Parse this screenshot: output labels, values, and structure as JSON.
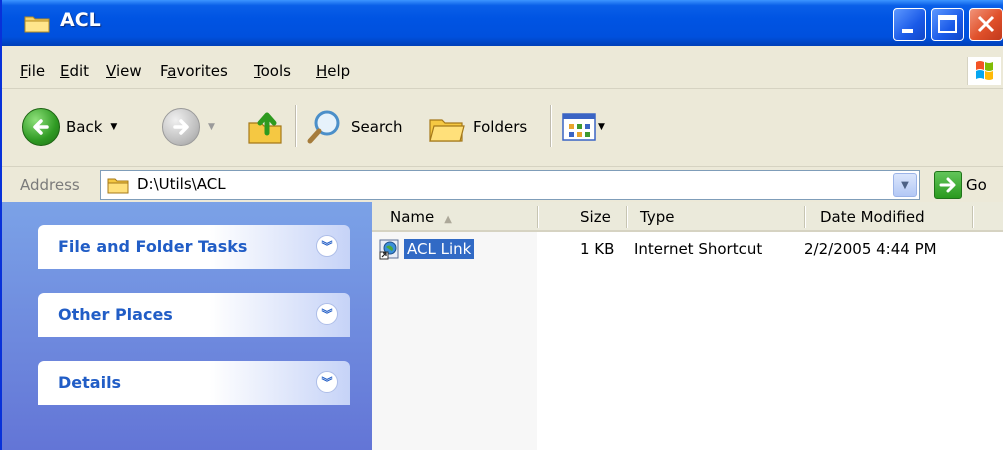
{
  "window": {
    "title": "ACL"
  },
  "menu": [
    {
      "label": "File",
      "key": "F",
      "rest": "ile"
    },
    {
      "label": "Edit",
      "key": "E",
      "rest": "dit"
    },
    {
      "label": "View",
      "key": "V",
      "rest": "iew"
    },
    {
      "label": "Favorites",
      "key": "a",
      "pre": "F",
      "rest": "vorites"
    },
    {
      "label": "Tools",
      "key": "T",
      "rest": "ools"
    },
    {
      "label": "Help",
      "key": "H",
      "rest": "elp"
    }
  ],
  "toolbar": {
    "back_label": "Back",
    "search_label": "Search",
    "folders_label": "Folders"
  },
  "address": {
    "label": "Address",
    "value": "D:\\Utils\\ACL",
    "go_label": "Go"
  },
  "task_pane": [
    {
      "title": "File and Folder Tasks"
    },
    {
      "title": "Other Places"
    },
    {
      "title": "Details"
    }
  ],
  "columns": {
    "name": "Name",
    "size": "Size",
    "type": "Type",
    "date": "Date Modified"
  },
  "files": [
    {
      "name": "ACL Link",
      "size": "1 KB",
      "type": "Internet Shortcut",
      "date": "2/2/2005 4:44 PM"
    }
  ],
  "colors": {
    "title_bar": "#0054e3",
    "task_pane": "#6f8fe0",
    "task_title": "#215dc6",
    "selection": "#316ac5"
  }
}
